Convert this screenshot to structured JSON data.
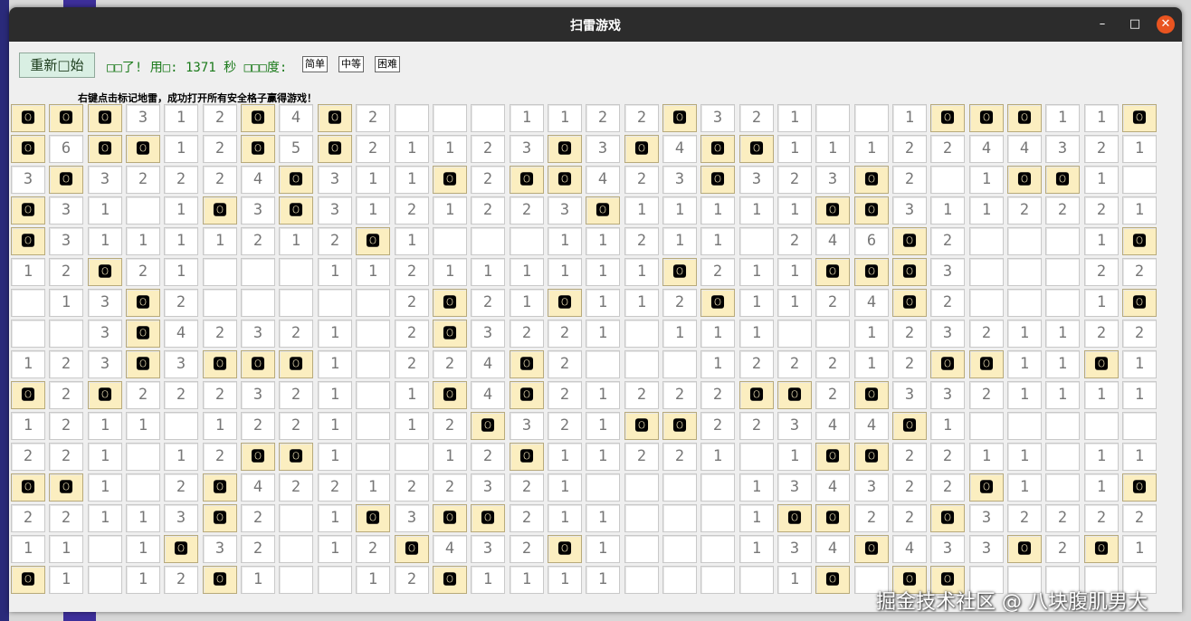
{
  "window": {
    "title": "扫雷游戏",
    "minimize_glyph": "–",
    "maximize_glyph": "□",
    "close_glyph": "✕",
    "close_color": "#e95420"
  },
  "toolbar": {
    "restart_label": "重新□始",
    "status_text": "□□了! 用□: 1371 秒 □□□度:",
    "difficulty": [
      "简单",
      "中等",
      "困难"
    ]
  },
  "hint": "右键点击标记地雷，成功打开所有安全格子赢得游戏！",
  "mine_glyph": "🅾",
  "board": {
    "rows": [
      [
        "M",
        "M",
        "M",
        "3",
        "1",
        "2",
        "M",
        "4",
        "M",
        "2",
        "",
        "",
        "",
        "1",
        "1",
        "2",
        "2",
        "M",
        "3",
        "2",
        "1",
        "",
        "",
        "1",
        "M",
        "M",
        "M",
        "1",
        "1",
        "M"
      ],
      [
        "M",
        "6",
        "M",
        "M",
        "1",
        "2",
        "M",
        "5",
        "M",
        "2",
        "1",
        "1",
        "2",
        "3",
        "M",
        "3",
        "M",
        "4",
        "M",
        "M",
        "1",
        "1",
        "1",
        "2",
        "2",
        "4",
        "4",
        "3",
        "2",
        "1"
      ],
      [
        "3",
        "M",
        "3",
        "2",
        "2",
        "2",
        "4",
        "M",
        "3",
        "1",
        "1",
        "M",
        "2",
        "M",
        "M",
        "4",
        "2",
        "3",
        "M",
        "3",
        "2",
        "3",
        "M",
        "2",
        "",
        "1",
        "M",
        "M",
        "1",
        ""
      ],
      [
        "M",
        "3",
        "1",
        "",
        "1",
        "M",
        "3",
        "M",
        "3",
        "1",
        "2",
        "1",
        "2",
        "2",
        "3",
        "M",
        "1",
        "1",
        "1",
        "1",
        "1",
        "M",
        "M",
        "3",
        "1",
        "1",
        "2",
        "2",
        "2",
        "1"
      ],
      [
        "M",
        "3",
        "1",
        "1",
        "1",
        "1",
        "2",
        "1",
        "2",
        "M",
        "1",
        "",
        "",
        "",
        "1",
        "1",
        "2",
        "1",
        "1",
        "",
        "2",
        "4",
        "6",
        "M",
        "2",
        "",
        "",
        "",
        "1",
        "M"
      ],
      [
        "1",
        "2",
        "M",
        "2",
        "1",
        "",
        "",
        "",
        "1",
        "1",
        "2",
        "1",
        "1",
        "1",
        "1",
        "1",
        "1",
        "M",
        "2",
        "1",
        "1",
        "M",
        "M",
        "M",
        "3",
        "",
        "",
        "",
        "2",
        "2"
      ],
      [
        "",
        "1",
        "3",
        "M",
        "2",
        "",
        "",
        "",
        "",
        "",
        "2",
        "M",
        "2",
        "1",
        "M",
        "1",
        "1",
        "2",
        "M",
        "1",
        "1",
        "2",
        "4",
        "M",
        "2",
        "",
        "",
        "",
        "1",
        "M"
      ],
      [
        "",
        "",
        "3",
        "M",
        "4",
        "2",
        "3",
        "2",
        "1",
        "",
        "2",
        "M",
        "3",
        "2",
        "2",
        "1",
        "",
        "1",
        "1",
        "1",
        "",
        "",
        "1",
        "2",
        "3",
        "2",
        "1",
        "1",
        "2",
        "2"
      ],
      [
        "1",
        "2",
        "3",
        "M",
        "3",
        "M",
        "M",
        "M",
        "1",
        "",
        "2",
        "2",
        "4",
        "M",
        "2",
        "",
        "",
        "",
        "1",
        "2",
        "2",
        "2",
        "1",
        "2",
        "M",
        "M",
        "1",
        "1",
        "M",
        "1"
      ],
      [
        "M",
        "2",
        "M",
        "2",
        "2",
        "2",
        "3",
        "2",
        "1",
        "",
        "1",
        "M",
        "4",
        "M",
        "2",
        "1",
        "2",
        "2",
        "2",
        "M",
        "M",
        "2",
        "M",
        "3",
        "3",
        "2",
        "1",
        "1",
        "1",
        "1"
      ],
      [
        "1",
        "2",
        "1",
        "1",
        "",
        "1",
        "2",
        "2",
        "1",
        "",
        "1",
        "2",
        "M",
        "3",
        "2",
        "1",
        "M",
        "M",
        "2",
        "2",
        "3",
        "4",
        "4",
        "M",
        "1",
        "",
        "",
        "",
        "",
        ""
      ],
      [
        "2",
        "2",
        "1",
        "",
        "1",
        "2",
        "M",
        "M",
        "1",
        "",
        "",
        "1",
        "2",
        "M",
        "1",
        "1",
        "2",
        "2",
        "1",
        "",
        "1",
        "M",
        "M",
        "2",
        "2",
        "1",
        "1",
        "",
        "1",
        "1"
      ],
      [
        "M",
        "M",
        "1",
        "",
        "2",
        "M",
        "4",
        "2",
        "2",
        "1",
        "2",
        "2",
        "3",
        "2",
        "1",
        "",
        "",
        "",
        "",
        "1",
        "3",
        "4",
        "3",
        "2",
        "2",
        "M",
        "1",
        "",
        "1",
        "M"
      ],
      [
        "2",
        "2",
        "1",
        "1",
        "3",
        "M",
        "2",
        "",
        "1",
        "M",
        "3",
        "M",
        "M",
        "2",
        "1",
        "1",
        "",
        "",
        "",
        "1",
        "M",
        "M",
        "2",
        "2",
        "M",
        "3",
        "2",
        "2",
        "2",
        "2"
      ],
      [
        "1",
        "1",
        "",
        "1",
        "M",
        "3",
        "2",
        "",
        "1",
        "2",
        "M",
        "4",
        "3",
        "2",
        "M",
        "1",
        "",
        "",
        "",
        "1",
        "3",
        "4",
        "M",
        "4",
        "3",
        "3",
        "M",
        "2",
        "M",
        "1"
      ],
      [
        "M",
        "1",
        "",
        "1",
        "2",
        "M",
        "1",
        "",
        "",
        "1",
        "2",
        "M",
        "1",
        "1",
        "1",
        "1",
        "",
        "",
        "",
        "",
        "1",
        "M",
        "",
        "M",
        "M",
        "",
        "",
        "",
        "",
        ""
      ]
    ]
  },
  "watermark": "掘金技术社区 @ 八块腹肌男大"
}
